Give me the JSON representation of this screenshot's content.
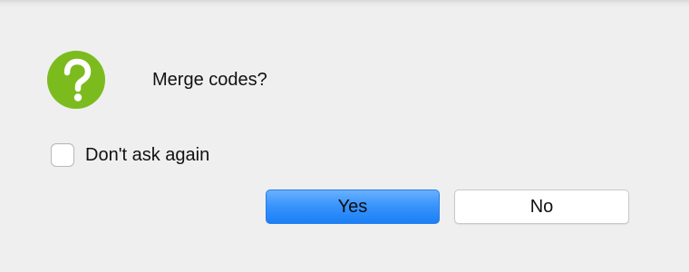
{
  "dialog": {
    "message": "Merge codes?",
    "icon": "question-icon",
    "checkbox": {
      "label": "Don't ask again",
      "checked": false
    },
    "buttons": {
      "yes_label": "Yes",
      "no_label": "No"
    },
    "colors": {
      "icon_green": "#7cbb1e",
      "primary_button": "#3a95fc",
      "background": "#efefef"
    }
  }
}
